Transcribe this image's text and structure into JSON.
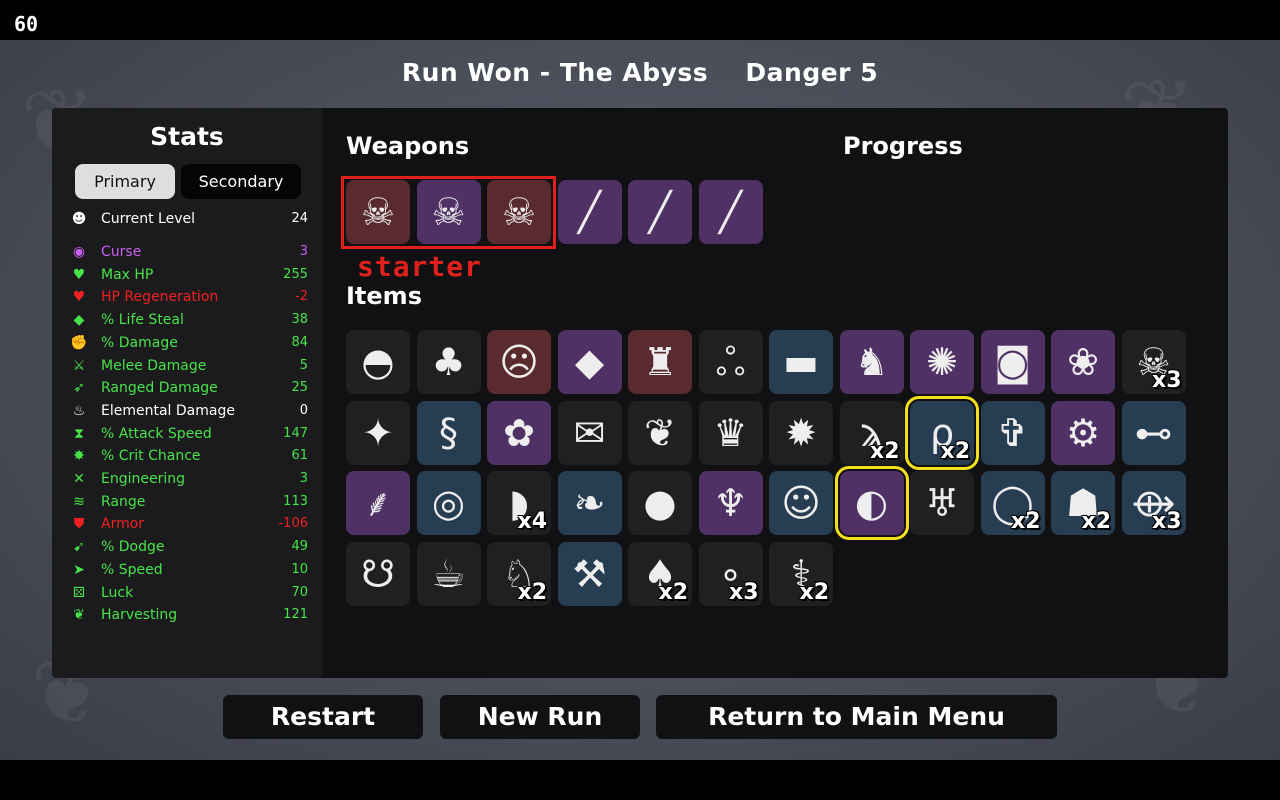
{
  "fps": "60",
  "header": {
    "title": "Run Won - The Abyss",
    "danger": "Danger 5"
  },
  "stats": {
    "title": "Stats",
    "tab_primary": "Primary",
    "tab_secondary": "Secondary",
    "rows": [
      {
        "label": "Current Level",
        "value": "24",
        "icon": "level-icon",
        "glyph": "☻",
        "color": "#ffffff",
        "value_color": "#ffffff"
      },
      {
        "label": "Curse",
        "value": "3",
        "icon": "curse-icon",
        "glyph": "◉",
        "color": "#c75ff0",
        "value_color": "#c75ff0"
      },
      {
        "label": "Max HP",
        "value": "255",
        "icon": "heart-icon",
        "glyph": "♥",
        "color": "#48e34a",
        "value_color": "#48e34a"
      },
      {
        "label": "HP Regeneration",
        "value": "-2",
        "icon": "hp-regen-icon",
        "glyph": "♥",
        "color": "#f02020",
        "value_color": "#f02020"
      },
      {
        "label": "% Life Steal",
        "value": "38",
        "icon": "life-steal-icon",
        "glyph": "◆",
        "color": "#48e34a",
        "value_color": "#48e34a"
      },
      {
        "label": "% Damage",
        "value": "84",
        "icon": "damage-icon",
        "glyph": "✊",
        "color": "#48e34a",
        "value_color": "#48e34a"
      },
      {
        "label": "Melee Damage",
        "value": "5",
        "icon": "sword-icon",
        "glyph": "⚔",
        "color": "#48e34a",
        "value_color": "#48e34a"
      },
      {
        "label": "Ranged Damage",
        "value": "25",
        "icon": "bow-icon",
        "glyph": "➶",
        "color": "#48e34a",
        "value_color": "#48e34a"
      },
      {
        "label": "Elemental Damage",
        "value": "0",
        "icon": "fire-icon",
        "glyph": "♨",
        "color": "#ffffff",
        "value_color": "#ffffff"
      },
      {
        "label": "% Attack Speed",
        "value": "147",
        "icon": "hourglass-icon",
        "glyph": "⧗",
        "color": "#48e34a",
        "value_color": "#48e34a"
      },
      {
        "label": "% Crit Chance",
        "value": "61",
        "icon": "crit-icon",
        "glyph": "✸",
        "color": "#48e34a",
        "value_color": "#48e34a"
      },
      {
        "label": "Engineering",
        "value": "3",
        "icon": "wrench-icon",
        "glyph": "✕",
        "color": "#48e34a",
        "value_color": "#48e34a"
      },
      {
        "label": "Range",
        "value": "113",
        "icon": "range-icon",
        "glyph": "≋",
        "color": "#48e34a",
        "value_color": "#48e34a"
      },
      {
        "label": "Armor",
        "value": "-106",
        "icon": "shield-icon",
        "glyph": "⛊",
        "color": "#f02020",
        "value_color": "#f02020"
      },
      {
        "label": "% Dodge",
        "value": "49",
        "icon": "dodge-icon",
        "glyph": "➹",
        "color": "#48e34a",
        "value_color": "#48e34a"
      },
      {
        "label": "% Speed",
        "value": "10",
        "icon": "boot-icon",
        "glyph": "➤",
        "color": "#48e34a",
        "value_color": "#48e34a"
      },
      {
        "label": "Luck",
        "value": "70",
        "icon": "dice-icon",
        "glyph": "⚄",
        "color": "#48e34a",
        "value_color": "#48e34a"
      },
      {
        "label": "Harvesting",
        "value": "121",
        "icon": "harvest-icon",
        "glyph": "❦",
        "color": "#48e34a",
        "value_color": "#48e34a"
      }
    ]
  },
  "weapons": {
    "title": "Weapons",
    "starter_label": "starter",
    "slots": [
      {
        "name": "skull-staff-icon",
        "glyph": "☠",
        "bg": "#5a2b2e"
      },
      {
        "name": "skull-staff-icon",
        "glyph": "☠",
        "bg": "#4f3166"
      },
      {
        "name": "skull-staff-icon",
        "glyph": "☠",
        "bg": "#5a2b2e"
      },
      {
        "name": "rocket-launcher-icon",
        "glyph": "╱",
        "bg": "#4f3166"
      },
      {
        "name": "rocket-launcher-icon",
        "glyph": "╱",
        "bg": "#4f3166"
      },
      {
        "name": "rocket-launcher-icon",
        "glyph": "╱",
        "bg": "#4f3166"
      }
    ]
  },
  "progress": {
    "title": "Progress"
  },
  "items": {
    "title": "Items",
    "slots": [
      {
        "name": "egg-icon",
        "glyph": "◓",
        "bg": "#202022",
        "count": ""
      },
      {
        "name": "tree-icon",
        "glyph": "♣",
        "bg": "#202022",
        "count": ""
      },
      {
        "name": "face-icon",
        "glyph": "☹",
        "bg": "#5a2b2e",
        "count": ""
      },
      {
        "name": "whetstone-icon",
        "glyph": "◆",
        "bg": "#4f3166",
        "count": ""
      },
      {
        "name": "red-cape-icon",
        "glyph": "♜",
        "bg": "#5a2b2e",
        "count": ""
      },
      {
        "name": "spiral-icon",
        "glyph": "ஃ",
        "bg": "#202022",
        "count": ""
      },
      {
        "name": "black-blob-icon",
        "glyph": "▬",
        "bg": "#273d52",
        "count": ""
      },
      {
        "name": "cat-icon",
        "glyph": "♞",
        "bg": "#4f3166",
        "count": ""
      },
      {
        "name": "peacock-icon",
        "glyph": "✺",
        "bg": "#4f3166",
        "count": ""
      },
      {
        "name": "jar-icon",
        "glyph": "◙",
        "bg": "#4f3166",
        "count": ""
      },
      {
        "name": "mouse-icon",
        "glyph": "❀",
        "bg": "#4f3166",
        "count": ""
      },
      {
        "name": "skull-icon",
        "glyph": "☠",
        "bg": "#202022",
        "count": "x3"
      },
      {
        "name": "dagger-icon",
        "glyph": "✦",
        "bg": "#202022",
        "count": ""
      },
      {
        "name": "worm-icon",
        "glyph": "§",
        "bg": "#273d52",
        "count": ""
      },
      {
        "name": "goldfish-icon",
        "glyph": "✿",
        "bg": "#4f3166",
        "count": ""
      },
      {
        "name": "banknote-icon",
        "glyph": "✉",
        "bg": "#202022",
        "count": ""
      },
      {
        "name": "butterfly-icon",
        "glyph": "❦",
        "bg": "#202022",
        "count": ""
      },
      {
        "name": "bat-icon",
        "glyph": "♛",
        "bg": "#202022",
        "count": ""
      },
      {
        "name": "dynamite-icon",
        "glyph": "✹",
        "bg": "#202022",
        "count": ""
      },
      {
        "name": "tentacle-icon",
        "glyph": "ϡ",
        "bg": "#202022",
        "count": "x2"
      },
      {
        "name": "black-whip-icon",
        "glyph": "ρ",
        "bg": "#273d52",
        "count": "x2",
        "highlight": true
      },
      {
        "name": "scarecrow-icon",
        "glyph": "✞",
        "bg": "#273d52",
        "count": ""
      },
      {
        "name": "tractor-icon",
        "glyph": "⚙",
        "bg": "#4f3166",
        "count": ""
      },
      {
        "name": "dumbbell-icon",
        "glyph": "⊷",
        "bg": "#273d52",
        "count": ""
      },
      {
        "name": "wheat-icon",
        "glyph": "⸙",
        "bg": "#4f3166",
        "count": ""
      },
      {
        "name": "spyglass-icon",
        "glyph": "◎",
        "bg": "#273d52",
        "count": ""
      },
      {
        "name": "fang-icon",
        "glyph": "◗",
        "bg": "#202022",
        "count": "x4"
      },
      {
        "name": "cocoon-icon",
        "glyph": "❧",
        "bg": "#273d52",
        "count": ""
      },
      {
        "name": "snowball-icon",
        "glyph": "●",
        "bg": "#202022",
        "count": ""
      },
      {
        "name": "demon-head-icon",
        "glyph": "♆",
        "bg": "#4f3166",
        "count": ""
      },
      {
        "name": "frog-icon",
        "glyph": "☺",
        "bg": "#273d52",
        "count": ""
      },
      {
        "name": "red-scarf-icon",
        "glyph": "◐",
        "bg": "#4f3166",
        "count": "",
        "highlight": true
      },
      {
        "name": "tooth-icon",
        "glyph": "♅",
        "bg": "#202022",
        "count": ""
      },
      {
        "name": "life-ring-icon",
        "glyph": "◯",
        "bg": "#273d52",
        "count": "x2"
      },
      {
        "name": "rock-pile-icon",
        "glyph": "☗",
        "bg": "#273d52",
        "count": "x2"
      },
      {
        "name": "fish-icon",
        "glyph": "⟴",
        "bg": "#273d52",
        "count": "x3"
      },
      {
        "name": "slug-icon",
        "glyph": "☋",
        "bg": "#202022",
        "count": ""
      },
      {
        "name": "coffee-cup-icon",
        "glyph": "☕",
        "bg": "#202022",
        "count": ""
      },
      {
        "name": "rabbit-icon",
        "glyph": "♘",
        "bg": "#202022",
        "count": "x2"
      },
      {
        "name": "wrench-tool-icon",
        "glyph": "⚒",
        "bg": "#273d52",
        "count": ""
      },
      {
        "name": "sack-icon",
        "glyph": "♠",
        "bg": "#202022",
        "count": "x2"
      },
      {
        "name": "pearls-icon",
        "glyph": "∘",
        "bg": "#202022",
        "count": "x3"
      },
      {
        "name": "syringe-icon",
        "glyph": "⚕",
        "bg": "#202022",
        "count": "x2"
      }
    ]
  },
  "buttons": {
    "restart": "Restart",
    "new_run": "New Run",
    "main_menu": "Return to Main Menu"
  }
}
